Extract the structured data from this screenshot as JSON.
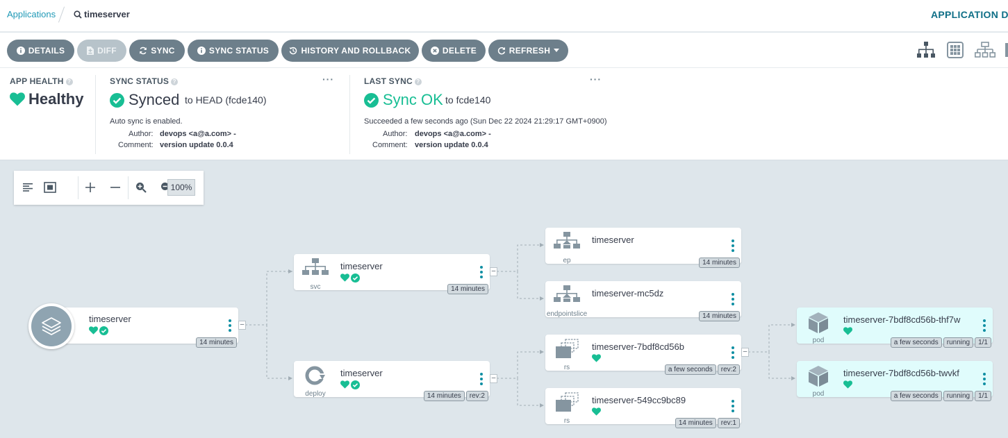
{
  "breadcrumb": {
    "root": "Applications",
    "current": "timeserver"
  },
  "header": {
    "title": "APPLICATION DI"
  },
  "toolbar": {
    "details": "DETAILS",
    "diff": "DIFF",
    "sync": "SYNC",
    "sync_status": "SYNC STATUS",
    "history": "HISTORY AND ROLLBACK",
    "delete": "DELETE",
    "refresh": "REFRESH"
  },
  "views": [
    "tree-view-icon",
    "pods-view-icon",
    "network-view-icon",
    "list-view-icon"
  ],
  "app_health": {
    "label": "APP HEALTH",
    "value": "Healthy"
  },
  "sync_status": {
    "label": "SYNC STATUS",
    "value": "Synced",
    "target": "to HEAD (fcde140)",
    "auto": "Auto sync is enabled.",
    "author_label": "Author:",
    "author": "devops <a@a.com> -",
    "comment_label": "Comment:",
    "comment": "version update 0.0.4"
  },
  "last_sync": {
    "label": "LAST SYNC",
    "value": "Sync OK",
    "target": "to fcde140",
    "time": "Succeeded a few seconds ago (Sun Dec 22 2024 21:29:17 GMT+0900)",
    "author_label": "Author:",
    "author": "devops <a@a.com> -",
    "comment_label": "Comment:",
    "comment": "version update 0.0.4"
  },
  "zoom": {
    "level": "100%"
  },
  "colors": {
    "healthy": "#18be94",
    "accent": "#0f8fa3",
    "button": "#6d7f8b"
  },
  "graph": {
    "app": {
      "name": "timeserver",
      "age": "14 minutes"
    },
    "svc": {
      "kind": "svc",
      "name": "timeserver",
      "age": "14 minutes"
    },
    "deploy": {
      "kind": "deploy",
      "name": "timeserver",
      "age": "14 minutes",
      "rev": "rev:2"
    },
    "ep": {
      "kind": "ep",
      "name": "timeserver",
      "age": "14 minutes"
    },
    "eps": {
      "kind": "endpointslice",
      "name": "timeserver-mc5dz",
      "age": "14 minutes"
    },
    "rs1": {
      "kind": "rs",
      "name": "timeserver-7bdf8cd56b",
      "age": "a few seconds",
      "rev": "rev:2"
    },
    "rs2": {
      "kind": "rs",
      "name": "timeserver-549cc9bc89",
      "age": "14 minutes",
      "rev": "rev:1"
    },
    "pod1": {
      "kind": "pod",
      "name": "timeserver-7bdf8cd56b-thf7w",
      "age": "a few seconds",
      "state": "running",
      "ready": "1/1"
    },
    "pod2": {
      "kind": "pod",
      "name": "timeserver-7bdf8cd56b-twvkf",
      "age": "a few seconds",
      "state": "running",
      "ready": "1/1"
    }
  }
}
